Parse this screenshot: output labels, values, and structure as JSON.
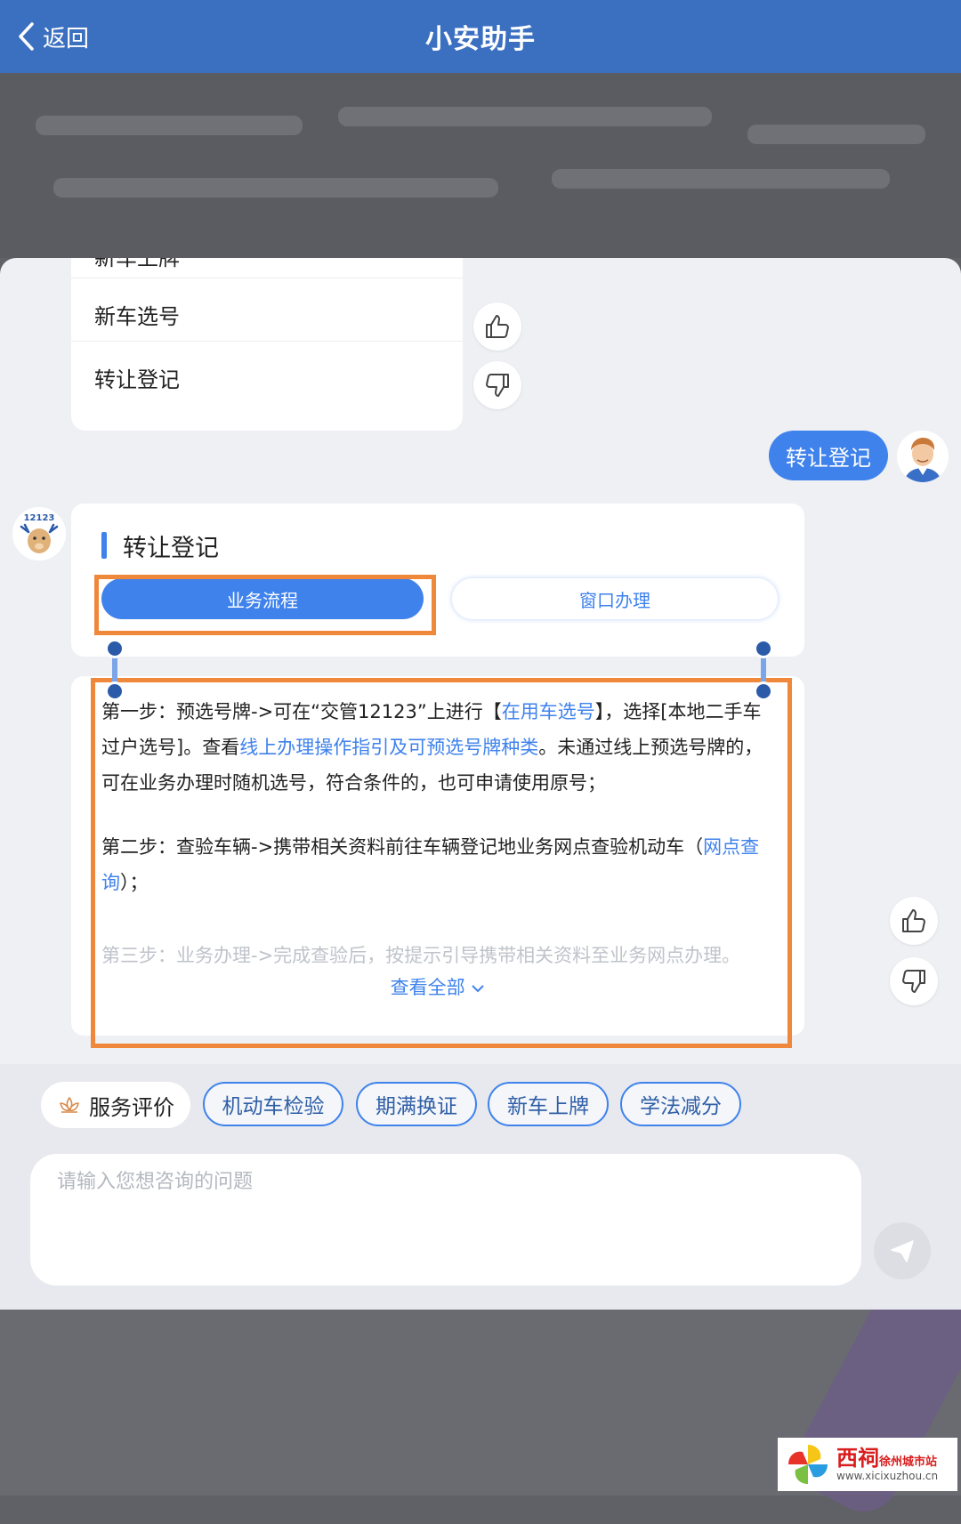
{
  "header": {
    "back_label": "返回",
    "title": "小安助手"
  },
  "menu": {
    "items": [
      {
        "label": "新车上牌"
      },
      {
        "label": "新车选号"
      },
      {
        "label": "转让登记"
      }
    ]
  },
  "user_message": "转让登记",
  "bot_card": {
    "title": "转让登记",
    "tab_primary": "业务流程",
    "tab_secondary": "窗口办理",
    "bot_avatar_label": "12123"
  },
  "content": {
    "step1_a": "第一步：预选号牌->可在“交管12123”上进行【",
    "step1_link1": "在用车选号",
    "step1_b": "】，选择[本地二手车过户选号]。查看",
    "step1_link2": "线上办理操作指引及可预选号牌种类",
    "step1_c": "。未通过线上预选号牌的，可在业务办理时随机选号，符合条件的，也可申请使用原号；",
    "step2_a": "第二步：查验车辆->携带相关资料前往车辆登记地业务网点查验机动车（",
    "step2_link": "网点查询",
    "step2_b": "）；",
    "step3": "第三步：业务办理->完成查验后，按提示引导携带相关资料至业务网点办理。",
    "view_all": "查看全部"
  },
  "quick_chips": {
    "rate_label": "服务评价",
    "items": [
      {
        "label": "机动车检验"
      },
      {
        "label": "期满换证"
      },
      {
        "label": "新车上牌"
      },
      {
        "label": "学法减分"
      }
    ]
  },
  "input": {
    "placeholder": "请输入您想咨询的问题"
  },
  "watermark": {
    "name": "西祠",
    "city": "徐州城市站",
    "site": "www.xicixuzhou.cn"
  },
  "colors": {
    "header": "#3b6fc0",
    "accent": "#3f82ec",
    "highlight": "#f0883c"
  }
}
